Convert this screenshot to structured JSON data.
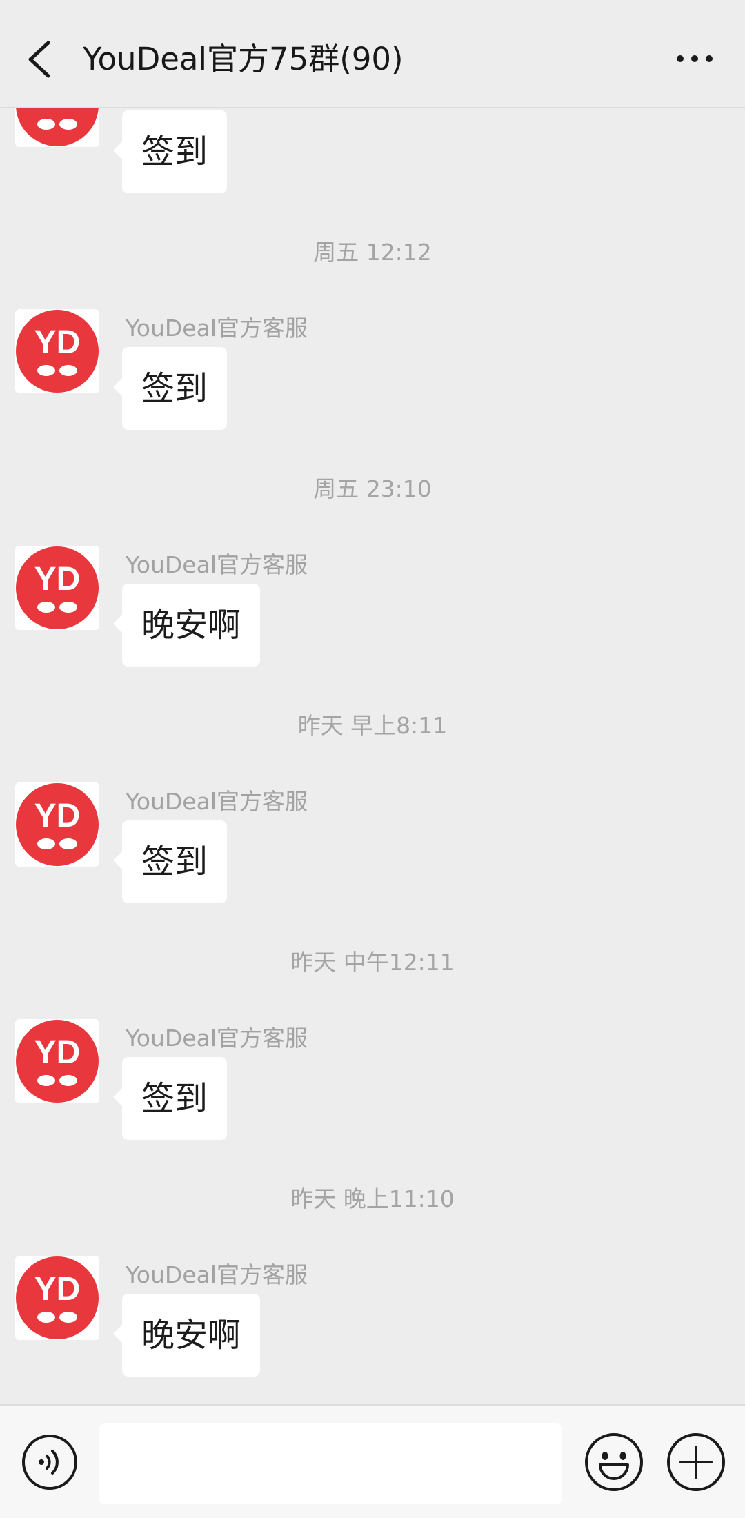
{
  "header": {
    "title": "YouDeal官方75群(90)",
    "back_icon": "chevron-left-icon",
    "more_icon": "more-dots-icon"
  },
  "avatar": {
    "text": "YD",
    "color": "#e8383d"
  },
  "messages": [
    {
      "timestamp": "",
      "sender": "",
      "text": "签到"
    },
    {
      "timestamp": "周五 12:12",
      "sender": "YouDeal官方客服",
      "text": "签到"
    },
    {
      "timestamp": "周五 23:10",
      "sender": "YouDeal官方客服",
      "text": "晚安啊"
    },
    {
      "timestamp": "昨天 早上8:11",
      "sender": "YouDeal官方客服",
      "text": "签到"
    },
    {
      "timestamp": "昨天 中午12:11",
      "sender": "YouDeal官方客服",
      "text": "签到"
    },
    {
      "timestamp": "昨天 晚上11:10",
      "sender": "YouDeal官方客服",
      "text": "晚安啊"
    }
  ],
  "input_bar": {
    "voice_icon": "voice-icon",
    "input_value": "",
    "emoji_icon": "emoji-icon",
    "plus_icon": "plus-icon"
  }
}
